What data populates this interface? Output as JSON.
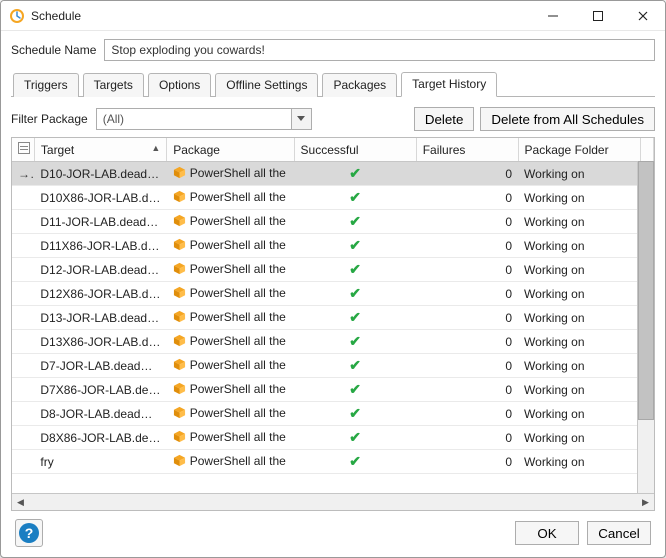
{
  "window": {
    "title": "Schedule",
    "icon": "schedule-icon"
  },
  "form": {
    "schedule_name_label": "Schedule Name",
    "schedule_name_value": "Stop exploding you cowards!"
  },
  "tabs": [
    {
      "id": "triggers",
      "label": "Triggers",
      "active": false
    },
    {
      "id": "targets",
      "label": "Targets",
      "active": false
    },
    {
      "id": "options",
      "label": "Options",
      "active": false
    },
    {
      "id": "offline",
      "label": "Offline Settings",
      "active": false
    },
    {
      "id": "packages",
      "label": "Packages",
      "active": false
    },
    {
      "id": "history",
      "label": "Target History",
      "active": true
    }
  ],
  "toolbar": {
    "filter_label": "Filter Package",
    "filter_value": "(All)",
    "delete_label": "Delete",
    "delete_all_label": "Delete from All Schedules"
  },
  "columns": {
    "c1": "Target",
    "c2": "Package",
    "c3": "Successful",
    "c4": "Failures",
    "c5": "Package Folder"
  },
  "rows": [
    {
      "selected": true,
      "target": "D10-JOR-LAB.dead…",
      "package": "PowerShell all the",
      "success": true,
      "failures": 0,
      "folder": "Working on"
    },
    {
      "selected": false,
      "target": "D10X86-JOR-LAB.d…",
      "package": "PowerShell all the",
      "success": true,
      "failures": 0,
      "folder": "Working on"
    },
    {
      "selected": false,
      "target": "D11-JOR-LAB.dead…",
      "package": "PowerShell all the",
      "success": true,
      "failures": 0,
      "folder": "Working on"
    },
    {
      "selected": false,
      "target": "D11X86-JOR-LAB.d…",
      "package": "PowerShell all the",
      "success": true,
      "failures": 0,
      "folder": "Working on"
    },
    {
      "selected": false,
      "target": "D12-JOR-LAB.dead…",
      "package": "PowerShell all the",
      "success": true,
      "failures": 0,
      "folder": "Working on"
    },
    {
      "selected": false,
      "target": "D12X86-JOR-LAB.d…",
      "package": "PowerShell all the",
      "success": true,
      "failures": 0,
      "folder": "Working on"
    },
    {
      "selected": false,
      "target": "D13-JOR-LAB.dead…",
      "package": "PowerShell all the",
      "success": true,
      "failures": 0,
      "folder": "Working on"
    },
    {
      "selected": false,
      "target": "D13X86-JOR-LAB.d…",
      "package": "PowerShell all the",
      "success": true,
      "failures": 0,
      "folder": "Working on"
    },
    {
      "selected": false,
      "target": "D7-JOR-LAB.dead…",
      "package": "PowerShell all the",
      "success": true,
      "failures": 0,
      "folder": "Working on"
    },
    {
      "selected": false,
      "target": "D7X86-JOR-LAB.de…",
      "package": "PowerShell all the",
      "success": true,
      "failures": 0,
      "folder": "Working on"
    },
    {
      "selected": false,
      "target": "D8-JOR-LAB.dead…",
      "package": "PowerShell all the",
      "success": true,
      "failures": 0,
      "folder": "Working on"
    },
    {
      "selected": false,
      "target": "D8X86-JOR-LAB.de…",
      "package": "PowerShell all the",
      "success": true,
      "failures": 0,
      "folder": "Working on"
    },
    {
      "selected": false,
      "target": "fry",
      "package": "PowerShell all the",
      "success": true,
      "failures": 0,
      "folder": "Working on"
    }
  ],
  "footer": {
    "ok_label": "OK",
    "cancel_label": "Cancel"
  }
}
